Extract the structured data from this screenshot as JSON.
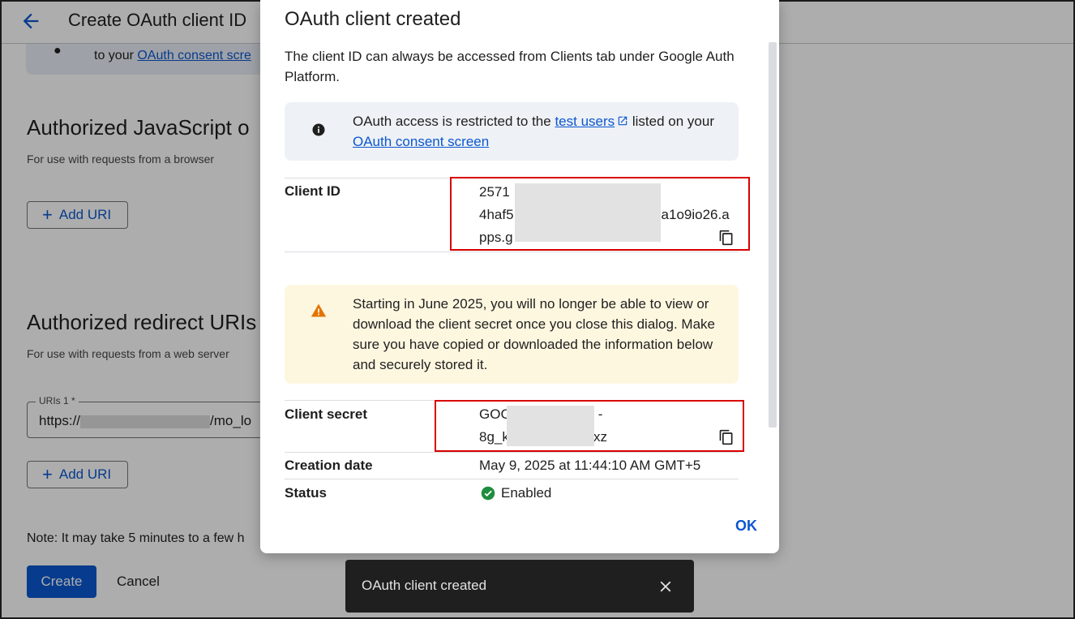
{
  "background": {
    "title": "Create OAuth client ID",
    "info_card": {
      "prefix": "to your ",
      "link": "OAuth consent scre"
    },
    "js_origins": {
      "title": "Authorized JavaScript o",
      "subtitle": "For use with requests from a browser",
      "add_uri_label": "Add URI"
    },
    "redirect_uris": {
      "title": "Authorized redirect URIs",
      "subtitle": "For use with requests from a web server",
      "field_label": "URIs 1 *",
      "field_value_prefix": "https://",
      "field_value_suffix": "/mo_lo",
      "add_uri_label": "Add URI"
    },
    "note": "Note: It may take 5 minutes to a few h",
    "create_label": "Create",
    "cancel_label": "Cancel"
  },
  "dialog": {
    "title": "OAuth client created",
    "description": "The client ID can always be accessed from Clients tab under Google Auth Platform.",
    "info_notice": {
      "before": "OAuth access is restricted to the ",
      "link1": "test users",
      "middle": " listed on your ",
      "link2": "OAuth consent screen"
    },
    "client_id": {
      "label": "Client ID",
      "line1": "2571",
      "line2_start": "4haf5",
      "line2_end": "a1o9io26.a",
      "line3": "pps.g"
    },
    "warning_notice": "Starting in June 2025, you will no longer be able to view or download the client secret once you close this dialog. Make sure you have copied or downloaded the information below and securely stored it.",
    "client_secret": {
      "label": "Client secret",
      "line1_start": "GOC",
      "line1_end": "-",
      "line2_start": "8g_k",
      "line2_end": "Oabxz"
    },
    "creation_date": {
      "label": "Creation date",
      "value": "May 9, 2025 at 11:44:10 AM GMT+5"
    },
    "status": {
      "label": "Status",
      "value": "Enabled"
    },
    "ok_label": "OK"
  },
  "snackbar": {
    "message": "OAuth client created"
  },
  "colors": {
    "accent": "#0b57d0",
    "highlight_box": "#d90000",
    "success": "#1e8e3e",
    "warning": "#e37400"
  }
}
